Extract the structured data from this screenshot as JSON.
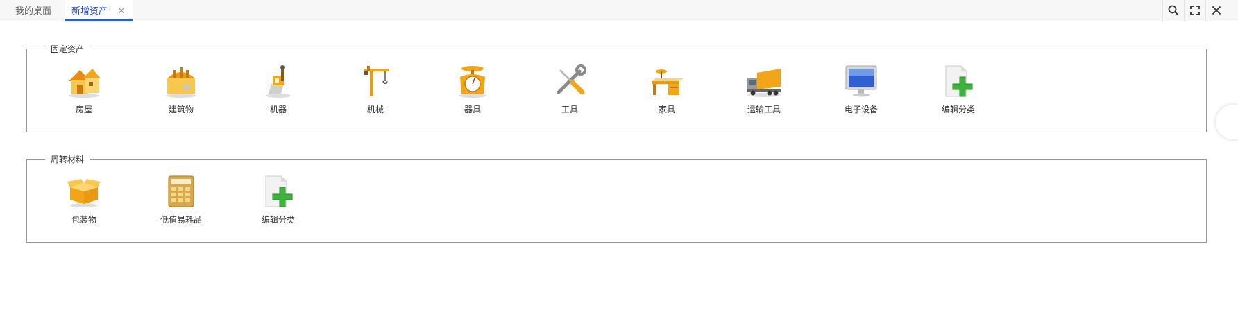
{
  "tabs": [
    {
      "label": "我的桌面"
    },
    {
      "label": "新增资产"
    }
  ],
  "toolbar": {
    "icons": [
      "search-icon",
      "fullscreen-icon",
      "close-icon"
    ]
  },
  "groups": [
    {
      "title": "固定资产",
      "items": [
        {
          "label": "房屋",
          "icon": "house-icon"
        },
        {
          "label": "建筑物",
          "icon": "building-icon"
        },
        {
          "label": "机器",
          "icon": "machine-icon"
        },
        {
          "label": "机械",
          "icon": "crane-icon"
        },
        {
          "label": "器具",
          "icon": "scale-icon"
        },
        {
          "label": "工具",
          "icon": "tools-icon"
        },
        {
          "label": "家具",
          "icon": "desk-icon"
        },
        {
          "label": "运输工具",
          "icon": "truck-icon"
        },
        {
          "label": "电子设备",
          "icon": "monitor-icon"
        },
        {
          "label": "编辑分类",
          "icon": "add-document-icon"
        }
      ]
    },
    {
      "title": "周转材料",
      "items": [
        {
          "label": "包装物",
          "icon": "box-icon"
        },
        {
          "label": "低值易耗品",
          "icon": "calculator-icon"
        },
        {
          "label": "编辑分类",
          "icon": "add-document-icon"
        }
      ]
    }
  ],
  "colors": {
    "accent": "#2a5bd7",
    "icon_orange": "#f2a516",
    "icon_green": "#3cb43c"
  }
}
